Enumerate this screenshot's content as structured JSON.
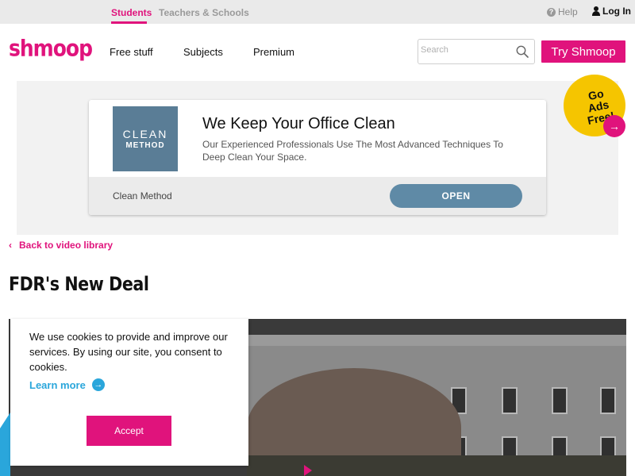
{
  "topbar": {
    "tabs": [
      {
        "label": "Students",
        "active": true
      },
      {
        "label": "Teachers & Schools",
        "active": false
      }
    ],
    "help_label": "Help",
    "login_label": "Log In"
  },
  "nav": {
    "logo_text": "shmoop",
    "links": [
      "Free stuff",
      "Subjects",
      "Premium"
    ],
    "search_placeholder": "Search",
    "cta_label": "Try Shmoop"
  },
  "ad": {
    "logo_line1": "CLEAN",
    "logo_line2": "METHOD",
    "title": "We Keep Your Office Clean",
    "description": "Our Experienced Professionals Use The Most Advanced Techniques To Deep Clean Your Space.",
    "brand": "Clean Method",
    "button_label": "OPEN"
  },
  "ads_free_badge": {
    "line1": "Go",
    "line2": "Ads Free!",
    "arrow": "→"
  },
  "content": {
    "back_link": "Back to video library",
    "back_chevron": "‹",
    "page_title": "FDR's New Deal"
  },
  "cookie": {
    "text": "We use cookies to provide and improve our services. By using our site, you consent to cookies.",
    "learn_more": "Learn more",
    "learn_more_arrow": "→",
    "accept_label": "Accept"
  },
  "colors": {
    "brand_pink": "#e0137c",
    "link_blue": "#2aa6db",
    "ad_blue": "#5f8aa6",
    "badge_yellow": "#f5c500"
  }
}
